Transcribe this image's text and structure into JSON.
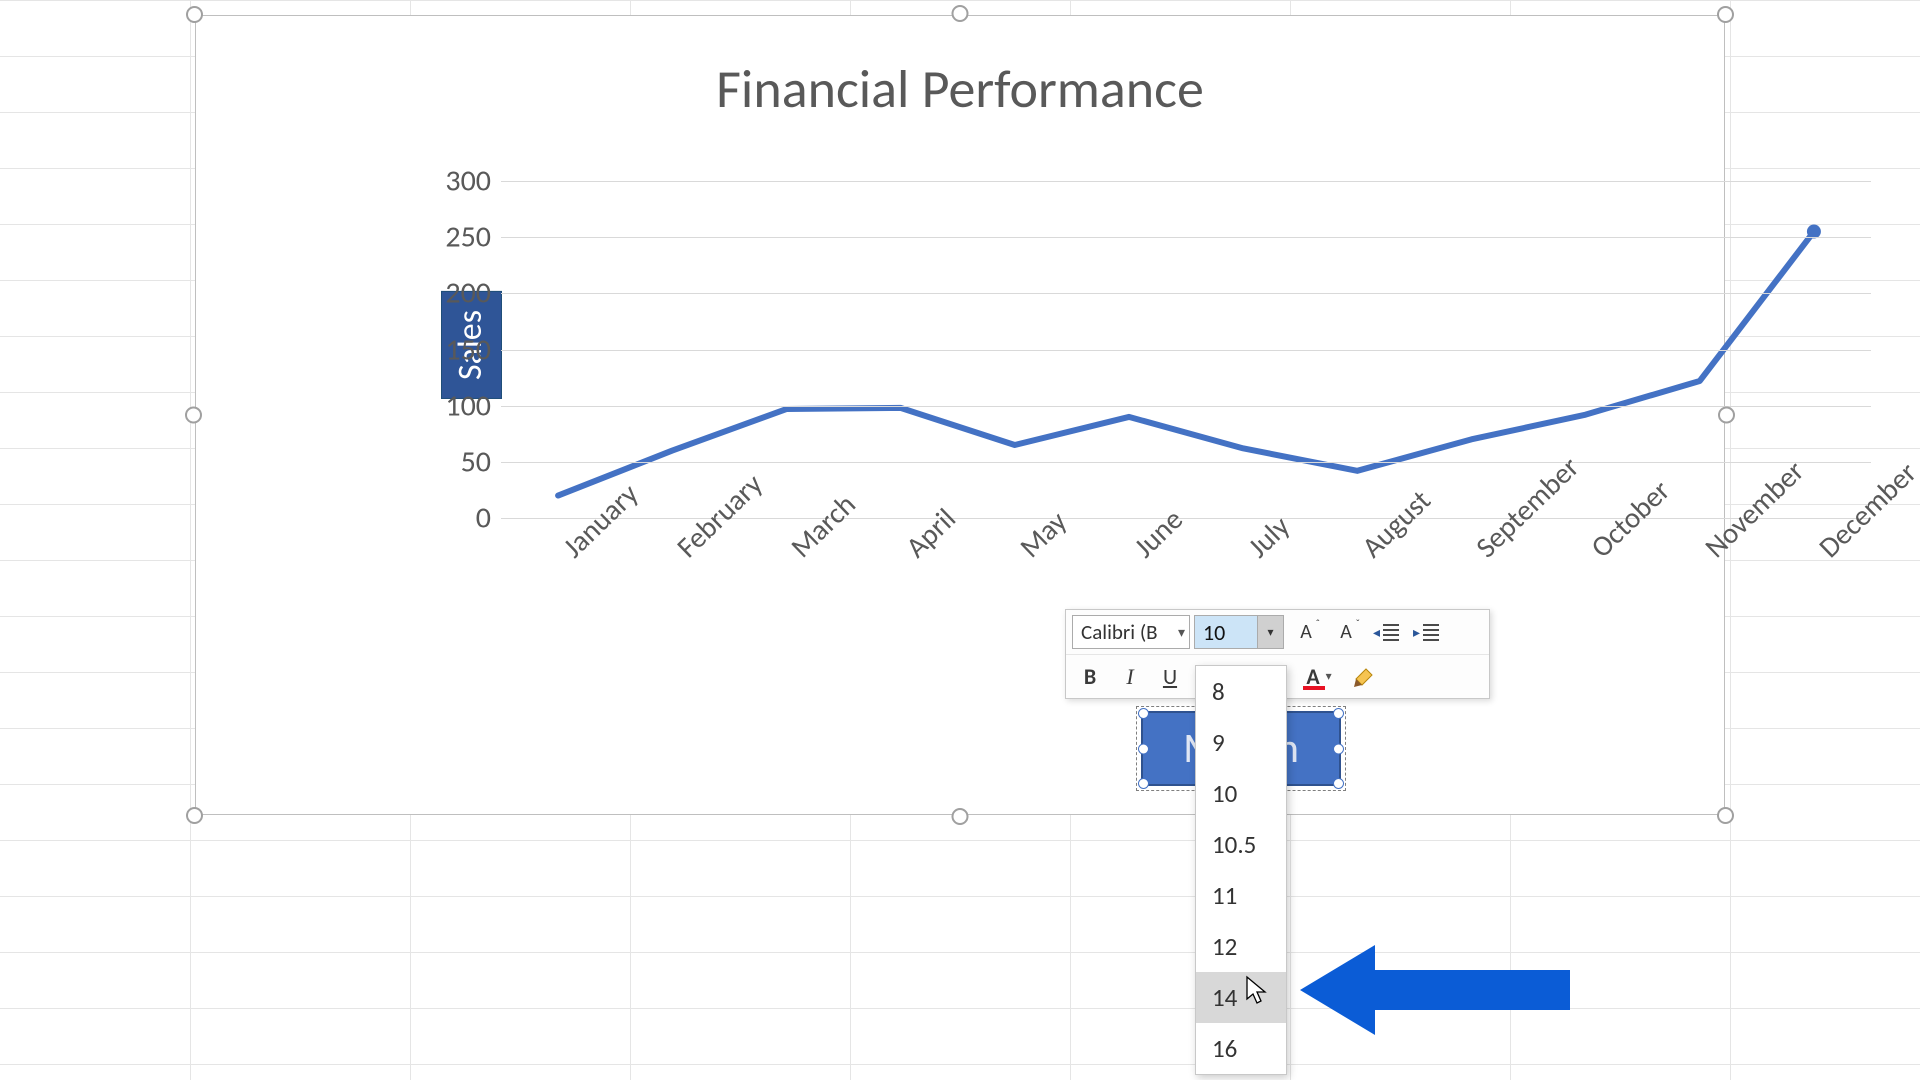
{
  "chart_data": {
    "type": "line",
    "title": "Financial Performance",
    "xlabel": "Month",
    "ylabel": "Sales",
    "ylim": [
      0,
      300
    ],
    "y_ticks": [
      0,
      50,
      100,
      150,
      200,
      250,
      300
    ],
    "categories": [
      "January",
      "February",
      "March",
      "April",
      "May",
      "June",
      "July",
      "August",
      "September",
      "October",
      "November",
      "December"
    ],
    "values": [
      20,
      60,
      97,
      98,
      65,
      90,
      62,
      42,
      70,
      92,
      122,
      255
    ],
    "line_color": "#4472c4"
  },
  "mini_toolbar": {
    "font_name": "Calibri (B",
    "font_size_value": "10",
    "row1": {
      "grow_font": "A",
      "shrink_font": "A"
    },
    "row2": {
      "bold": "B",
      "italic": "I",
      "underline": "U",
      "font_color_letter": "A"
    }
  },
  "font_size_dropdown": {
    "options": [
      "8",
      "9",
      "10",
      "10.5",
      "11",
      "12",
      "14",
      "16"
    ],
    "hovered": "14"
  },
  "colors": {
    "accent": "#4472c4",
    "accent_dark": "#2f5597",
    "arrow": "#0b5cd6"
  }
}
